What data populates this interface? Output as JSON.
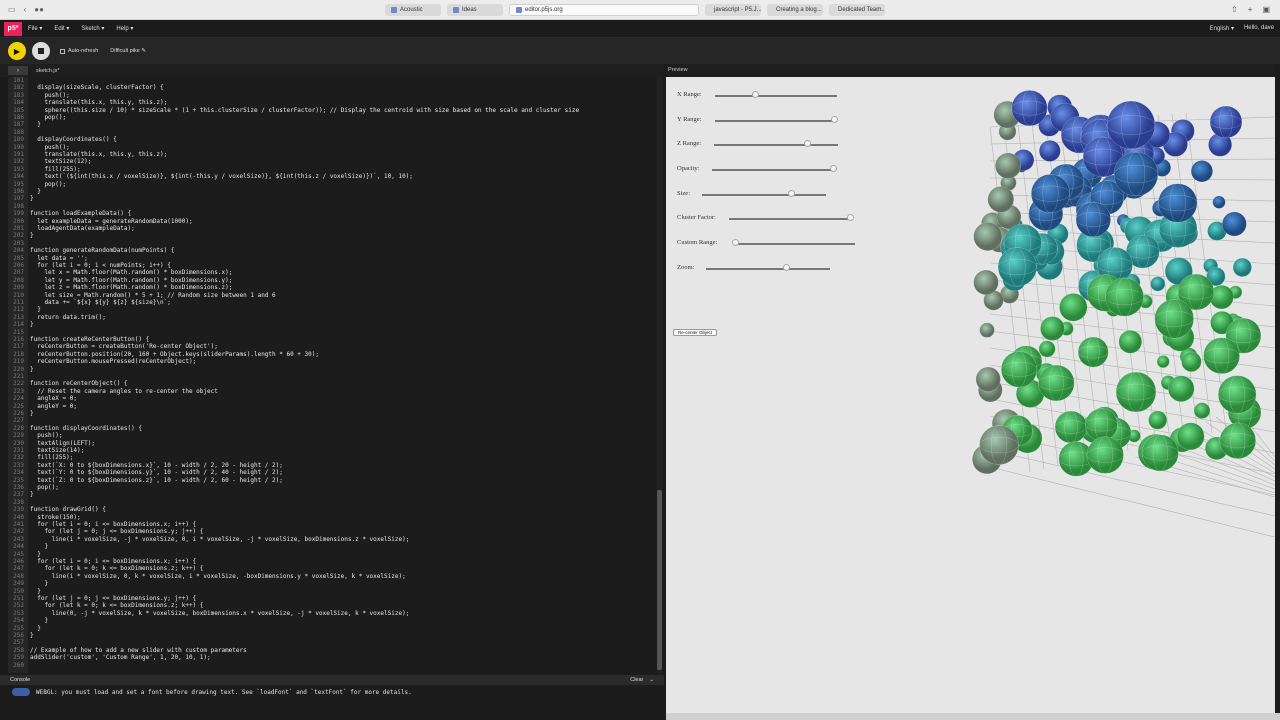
{
  "browser": {
    "tabs": [
      {
        "label": "Acoustic",
        "active": false
      },
      {
        "label": "Ideas",
        "active": false
      },
      {
        "label": "editor.p5js.org",
        "active": true
      },
      {
        "label": "javascript - P5.J...",
        "active": false
      },
      {
        "label": "Creating a blog...",
        "active": false
      },
      {
        "label": "Dedicated Team...",
        "active": false
      }
    ]
  },
  "menu": {
    "logo": "p5*",
    "items": [
      "File ▾",
      "Edit ▾",
      "Sketch ▾",
      "Help ▾"
    ],
    "language": "English ▾",
    "user": "Hello, dave"
  },
  "toolbar": {
    "auto_refresh": "Auto-refresh",
    "project_name": "Difficult pike ✎"
  },
  "editor": {
    "file_tab": "sketch.js*",
    "lines": [
      {
        "n": "181",
        "t": ""
      },
      {
        "n": "182",
        "t": "  display(sizeScale, clusterFactor) {"
      },
      {
        "n": "183",
        "t": "    push();"
      },
      {
        "n": "184",
        "t": "    translate(this.x, this.y, this.z);"
      },
      {
        "n": "185",
        "t": "    sphere((this.size / 10) * sizeScale * (1 + this.clusterSize / clusterFactor)); // Display the centroid with size based on the scale and cluster size"
      },
      {
        "n": "186",
        "t": "    pop();"
      },
      {
        "n": "187",
        "t": "  }"
      },
      {
        "n": "188",
        "t": ""
      },
      {
        "n": "189",
        "t": "  displayCoordinates() {"
      },
      {
        "n": "190",
        "t": "    push();"
      },
      {
        "n": "191",
        "t": "    translate(this.x, this.y, this.z);"
      },
      {
        "n": "192",
        "t": "    textSize(12);"
      },
      {
        "n": "193",
        "t": "    fill(255);"
      },
      {
        "n": "194",
        "t": "    text(`(${int(this.x / voxelSize)}, ${int(-this.y / voxelSize)}, ${int(this.z / voxelSize)})`, 10, 10);"
      },
      {
        "n": "195",
        "t": "    pop();"
      },
      {
        "n": "196",
        "t": "  }"
      },
      {
        "n": "197",
        "t": "}"
      },
      {
        "n": "198",
        "t": ""
      },
      {
        "n": "199",
        "t": "function loadExampleData() {"
      },
      {
        "n": "200",
        "t": "  let exampleData = generateRandomData(1000);"
      },
      {
        "n": "201",
        "t": "  loadAgentData(exampleData);"
      },
      {
        "n": "202",
        "t": "}"
      },
      {
        "n": "203",
        "t": ""
      },
      {
        "n": "204",
        "t": "function generateRandomData(numPoints) {"
      },
      {
        "n": "205",
        "t": "  let data = '';"
      },
      {
        "n": "206",
        "t": "  for (let i = 0; i < numPoints; i++) {"
      },
      {
        "n": "207",
        "t": "    let x = Math.floor(Math.random() * boxDimensions.x);"
      },
      {
        "n": "208",
        "t": "    let y = Math.floor(Math.random() * boxDimensions.y);"
      },
      {
        "n": "209",
        "t": "    let z = Math.floor(Math.random() * boxDimensions.z);"
      },
      {
        "n": "210",
        "t": "    let size = Math.random() * 5 + 1; // Random size between 1 and 6"
      },
      {
        "n": "211",
        "t": "    data += `${x} ${y} ${z} ${size}\\n`;"
      },
      {
        "n": "212",
        "t": "  }"
      },
      {
        "n": "213",
        "t": "  return data.trim();"
      },
      {
        "n": "214",
        "t": "}"
      },
      {
        "n": "215",
        "t": ""
      },
      {
        "n": "216",
        "t": "function createReCenterButton() {"
      },
      {
        "n": "217",
        "t": "  reCenterButton = createButton('Re-center Object');"
      },
      {
        "n": "218",
        "t": "  reCenterButton.position(20, 160 + Object.keys(sliderParams).length * 60 + 30);"
      },
      {
        "n": "219",
        "t": "  reCenterButton.mousePressed(reCenterObject);"
      },
      {
        "n": "220",
        "t": "}"
      },
      {
        "n": "221",
        "t": ""
      },
      {
        "n": "222",
        "t": "function reCenterObject() {"
      },
      {
        "n": "223",
        "t": "  // Reset the camera angles to re-center the object"
      },
      {
        "n": "224",
        "t": "  angleX = 0;"
      },
      {
        "n": "225",
        "t": "  angleY = 0;"
      },
      {
        "n": "226",
        "t": "}"
      },
      {
        "n": "227",
        "t": ""
      },
      {
        "n": "228",
        "t": "function displayCoordinates() {"
      },
      {
        "n": "229",
        "t": "  push();"
      },
      {
        "n": "230",
        "t": "  textAlign(LEFT);"
      },
      {
        "n": "231",
        "t": "  textSize(14);"
      },
      {
        "n": "232",
        "t": "  fill(255);"
      },
      {
        "n": "233",
        "t": "  text(`X: 0 to ${boxDimensions.x}`, 10 - width / 2, 20 - height / 2);"
      },
      {
        "n": "234",
        "t": "  text(`Y: 0 to ${boxDimensions.y}`, 10 - width / 2, 40 - height / 2);"
      },
      {
        "n": "235",
        "t": "  text(`Z: 0 to ${boxDimensions.z}`, 10 - width / 2, 60 - height / 2);"
      },
      {
        "n": "236",
        "t": "  pop();"
      },
      {
        "n": "237",
        "t": "}"
      },
      {
        "n": "238",
        "t": ""
      },
      {
        "n": "239",
        "t": "function drawGrid() {"
      },
      {
        "n": "240",
        "t": "  stroke(150);"
      },
      {
        "n": "241",
        "t": "  for (let i = 0; i <= boxDimensions.x; i++) {"
      },
      {
        "n": "242",
        "t": "    for (let j = 0; j <= boxDimensions.y; j++) {"
      },
      {
        "n": "243",
        "t": "      line(i * voxelSize, -j * voxelSize, 0, i * voxelSize, -j * voxelSize, boxDimensions.z * voxelSize);"
      },
      {
        "n": "244",
        "t": "    }"
      },
      {
        "n": "245",
        "t": "  }"
      },
      {
        "n": "246",
        "t": "  for (let i = 0; i <= boxDimensions.x; i++) {"
      },
      {
        "n": "247",
        "t": "    for (let k = 0; k <= boxDimensions.z; k++) {"
      },
      {
        "n": "248",
        "t": "      line(i * voxelSize, 0, k * voxelSize, i * voxelSize, -boxDimensions.y * voxelSize, k * voxelSize);"
      },
      {
        "n": "249",
        "t": "    }"
      },
      {
        "n": "250",
        "t": "  }"
      },
      {
        "n": "251",
        "t": "  for (let j = 0; j <= boxDimensions.y; j++) {"
      },
      {
        "n": "252",
        "t": "    for (let k = 0; k <= boxDimensions.z; k++) {"
      },
      {
        "n": "253",
        "t": "      line(0, -j * voxelSize, k * voxelSize, boxDimensions.x * voxelSize, -j * voxelSize, k * voxelSize);"
      },
      {
        "n": "254",
        "t": "    }"
      },
      {
        "n": "255",
        "t": "  }"
      },
      {
        "n": "256",
        "t": "}"
      },
      {
        "n": "257",
        "t": ""
      },
      {
        "n": "258",
        "t": "// Example of how to add a new slider with custom parameters"
      },
      {
        "n": "259",
        "t": "addSlider('custom', 'Custom Range', 1, 20, 10, 1);"
      },
      {
        "n": "260",
        "t": ""
      }
    ]
  },
  "preview": {
    "title": "Preview",
    "sliders": [
      {
        "label": "X Range:",
        "fraction": 0.33
      },
      {
        "label": "Y Range:",
        "fraction": 0.98
      },
      {
        "label": "Z Range:",
        "fraction": 0.75
      },
      {
        "label": "Opacity:",
        "fraction": 0.98
      },
      {
        "label": "Size:",
        "fraction": 0.72
      },
      {
        "label": "Cluster Factor:",
        "fraction": 0.98
      },
      {
        "label": "Custom Range:",
        "fraction": 0.02
      },
      {
        "label": "Zoom:",
        "fraction": 0.65
      }
    ],
    "recenter_button": "Re-center Object"
  },
  "console": {
    "title": "Console",
    "clear": "Clear",
    "message": "WEBGL: you must load and set a font before drawing text. See `loadFont` and `textFont` for more details."
  },
  "colors": {
    "p5_pink": "#ed225d",
    "play_yellow": "#f2d200",
    "editor_bg": "#1c1c1c",
    "preview_bg": "#e6e6e6"
  }
}
